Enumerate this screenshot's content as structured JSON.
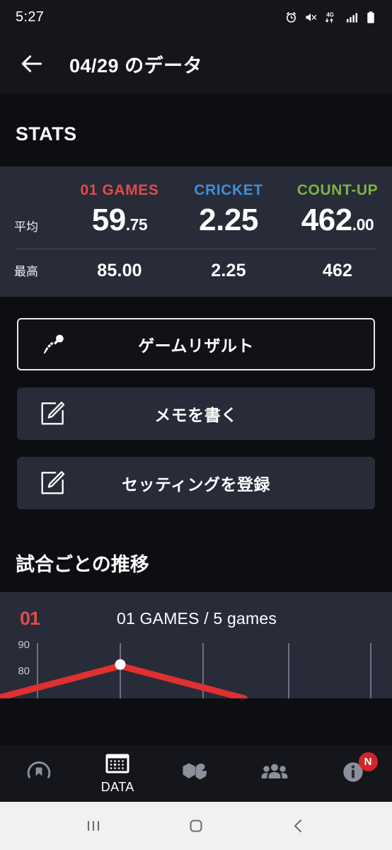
{
  "status_bar": {
    "time": "5:27",
    "icons": [
      "alarm-icon",
      "mute-icon",
      "4g-icon",
      "signal-icon",
      "battery-icon"
    ],
    "network_label": "4G"
  },
  "app_bar": {
    "back_icon": "back-arrow-icon",
    "title": "04/29 のデータ"
  },
  "stats": {
    "title": "STATS",
    "columns": [
      {
        "label": "01 GAMES",
        "color": "#e24a4a"
      },
      {
        "label": "CRICKET",
        "color": "#3f8fd8"
      },
      {
        "label": "COUNT-UP",
        "color": "#7cb342"
      }
    ],
    "rows": [
      {
        "label": "平均",
        "values": [
          {
            "int": "59",
            "dec": ".75"
          },
          {
            "int": "2.25",
            "dec": ""
          },
          {
            "int": "462",
            "dec": ".00"
          }
        ]
      },
      {
        "label": "最高",
        "values": [
          {
            "int": "85.00",
            "dec": ""
          },
          {
            "int": "2.25",
            "dec": ""
          },
          {
            "int": "462",
            "dec": ""
          }
        ]
      }
    ]
  },
  "actions": [
    {
      "label": "ゲームリザルト",
      "icon": "dart-icon",
      "style": "outlined"
    },
    {
      "label": "メモを書く",
      "icon": "edit-square-icon",
      "style": "filled"
    },
    {
      "label": "セッティングを登録",
      "icon": "edit-square-icon",
      "style": "filled"
    }
  ],
  "chart_section": {
    "title": "試合ごとの推移",
    "badge": "01",
    "caption": "01 GAMES / 5 games"
  },
  "chart_data": {
    "type": "line",
    "title": "01 GAMES / 5 games",
    "xlabel": "",
    "ylabel": "",
    "ylim": [
      75,
      92
    ],
    "yticks": [
      90,
      80
    ],
    "ytick_labels": [
      "90",
      "80"
    ],
    "grid": true,
    "grid_x": [
      1,
      2,
      3,
      4,
      5
    ],
    "legend": "none",
    "series": [
      {
        "name": "01 GAMES",
        "color": "#e03030",
        "x": [
          1,
          2,
          3
        ],
        "values": [
          75,
          85,
          75
        ],
        "marker_points": [
          {
            "x": 2,
            "y": 85
          }
        ]
      }
    ]
  },
  "bottom_nav": {
    "items": [
      {
        "name": "home",
        "icon": "dartboard-icon",
        "label": "",
        "active": false,
        "badge": ""
      },
      {
        "name": "data",
        "icon": "calendar-icon",
        "label": "DATA",
        "active": true,
        "badge": ""
      },
      {
        "name": "flights",
        "icon": "dart-flight-icon",
        "label": "",
        "active": false,
        "badge": ""
      },
      {
        "name": "community",
        "icon": "people-icon",
        "label": "",
        "active": false,
        "badge": ""
      },
      {
        "name": "info",
        "icon": "info-icon",
        "label": "",
        "active": false,
        "badge": "N"
      }
    ]
  },
  "android_nav": {
    "recents_icon": "recents-icon",
    "home_icon": "home-icon",
    "back_icon": "back-icon"
  }
}
